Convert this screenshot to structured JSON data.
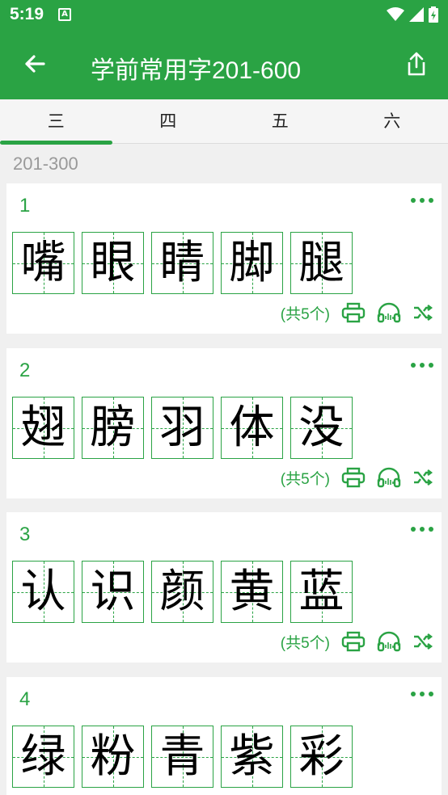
{
  "status_bar": {
    "time": "5:19",
    "notification_icon": "A"
  },
  "app_bar": {
    "title": "学前常用字201-600"
  },
  "tabs": [
    {
      "label": "三",
      "active": true
    },
    {
      "label": "四",
      "active": false
    },
    {
      "label": "五",
      "active": false
    },
    {
      "label": "六",
      "active": false
    }
  ],
  "section_header": "201-300",
  "groups": [
    {
      "number": "1",
      "chars": [
        "嘴",
        "眼",
        "睛",
        "脚",
        "腿"
      ],
      "count_label": "(共5个)"
    },
    {
      "number": "2",
      "chars": [
        "翅",
        "膀",
        "羽",
        "体",
        "没"
      ],
      "count_label": "(共5个)"
    },
    {
      "number": "3",
      "chars": [
        "认",
        "识",
        "颜",
        "黄",
        "蓝"
      ],
      "count_label": "(共5个)"
    },
    {
      "number": "4",
      "chars": [
        "绿",
        "粉",
        "青",
        "紫",
        "彩"
      ],
      "count_label": ""
    }
  ],
  "colors": {
    "accent": "#2aa344",
    "background": "#f0f0f0"
  },
  "icons": [
    "back-arrow-icon",
    "share-icon",
    "more-icon",
    "print-icon",
    "headphones-icon",
    "shuffle-icon",
    "wifi-icon",
    "signal-icon",
    "battery-icon"
  ]
}
